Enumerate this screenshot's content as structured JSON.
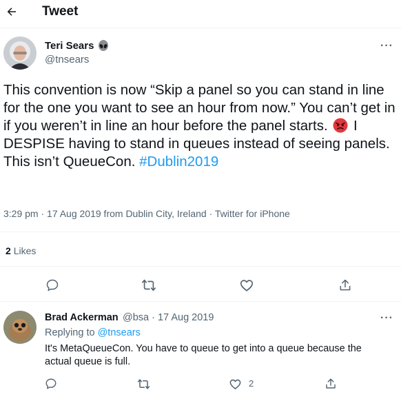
{
  "header": {
    "title": "Tweet",
    "back_icon": "arrow-left-icon"
  },
  "tweet": {
    "author_name": "Teri Sears",
    "author_badge": "alien-icon",
    "handle": "@tnsears",
    "text_part1": "This convention is now “Skip a panel so you can stand in line for the one you want to see an hour from now.” You can’t get in if you weren’t in line an hour before the panel starts.",
    "text_emoji": "angry-face-emoji",
    "text_part2": "I DESPISE having to stand in queues instead of seeing panels. This isn’t QueueCon.",
    "hashtag": "#Dublin2019",
    "meta": "3:29 pm · 17 Aug 2019 from Dublin City, Ireland · Twitter for iPhone",
    "likes_count": "2",
    "likes_label": "Likes",
    "more_label": "···"
  },
  "reply": {
    "author_name": "Brad Ackerman",
    "handle_date": "@bsa · 17 Aug 2019",
    "replying_label": "Replying to",
    "replying_handle": "@tnsears",
    "text": "It's MetaQueueCon. You have to queue to get into a queue because the actual queue is full.",
    "like_count": "2",
    "more_label": "···"
  },
  "colors": {
    "accent": "#1d9bf0",
    "muted": "#536471",
    "text": "#0f1419",
    "divider": "#eff3f4"
  }
}
